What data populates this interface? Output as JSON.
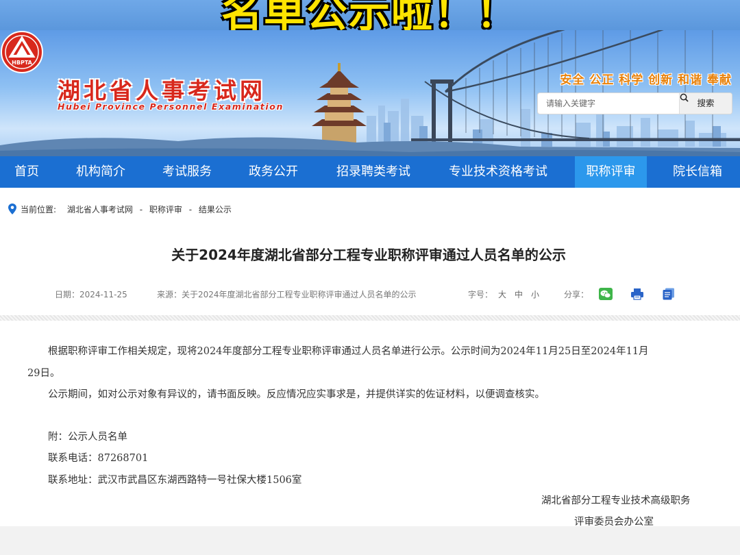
{
  "caption": {
    "text": "名单公示啦！！"
  },
  "site": {
    "logo_badge": "HBPTA",
    "name_cn": "湖北省人事考试网",
    "name_en": "Hubei  Province  Personnel  Examination",
    "slogan": "安全  公正  科学  创新  和谐  奉献"
  },
  "search": {
    "placeholder": "请输入关键字",
    "button_label": "搜索",
    "icon": "search-icon"
  },
  "nav": {
    "items": [
      {
        "label": "首页"
      },
      {
        "label": "机构简介"
      },
      {
        "label": "考试服务"
      },
      {
        "label": "政务公开"
      },
      {
        "label": "招录聘类考试"
      },
      {
        "label": "专业技术资格考试"
      },
      {
        "label": "职称评审",
        "active": true
      },
      {
        "label": "院长信箱"
      }
    ],
    "color": "#1b6fd2",
    "active_color": "#2c98ec"
  },
  "breadcrumb": {
    "prefix": "当前位置:",
    "items": [
      "湖北省人事考试网",
      "职称评审",
      "结果公示"
    ],
    "separator": "-"
  },
  "article": {
    "title": "关于2024年度湖北省部分工程专业职称评审通过人员名单的公示",
    "date": "日期：2024-11-25",
    "source": "来源：关于2024年度湖北省部分工程专业职称评审通过人员名单的公示",
    "font_label": "字号：",
    "font_sizes": [
      "大",
      "中",
      "小"
    ],
    "share_label": "分享：",
    "share_icons": [
      "wechat-icon",
      "print-icon",
      "copy-icon"
    ],
    "para1_line1": "根据职称评审工作相关规定，现将2024年度部分工程专业职称评审通过人员名单进行公示。公示时间为2024年11月25日至2024年11月",
    "para1_line2": "29日。",
    "para2": "公示期间，如对公示对象有异议的，请书面反映。反应情况应实事求是，并提供详实的佐证材料，以便调查核实。",
    "attachment": "附：公示人员名单",
    "phone": "联系电话：87268701",
    "address": "联系地址：武汉市武昌区东湖西路特一号社保大楼1506室",
    "sign_line1": "湖北省部分工程专业技术高级职务",
    "sign_line2": "评审委员会办公室"
  }
}
